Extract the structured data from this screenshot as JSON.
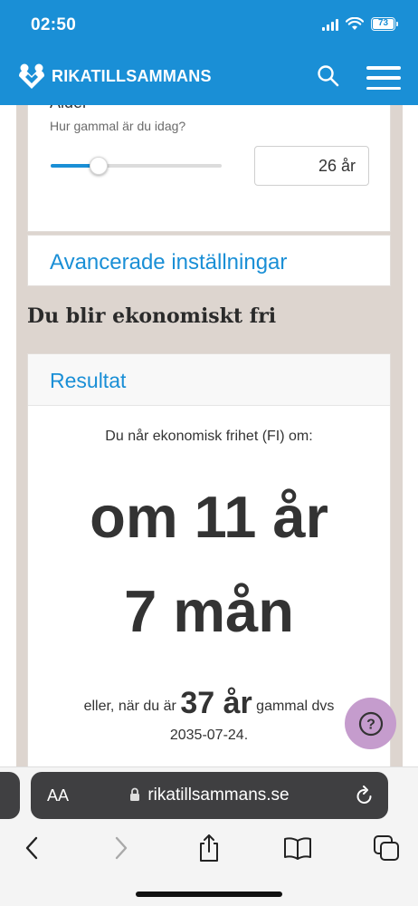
{
  "status_bar": {
    "time": "02:50",
    "battery": "73"
  },
  "header": {
    "logo_text": "RIKATILLSAMMANS"
  },
  "age_card": {
    "label": "Ålder",
    "hint": "Hur gammal är du idag?",
    "slider_fraction": 0.28,
    "value": "26 år"
  },
  "advanced": {
    "label": "Avancerade inställningar"
  },
  "section_title": "Du blir ekonomiskt fri",
  "result": {
    "header": "Resultat",
    "intro": "Du når ekonomisk frihet (FI) om:",
    "years": "om 11 år",
    "months": "7 mån",
    "line_prefix": "eller, när du är",
    "age": "37 år",
    "line_suffix": "gammal dvs",
    "date": "2035-07-24."
  },
  "help": {
    "label": "?"
  },
  "browser": {
    "aa_label": "AA",
    "url": "rikatillsammans.se"
  },
  "colors": {
    "brand_blue": "#1a8fd6",
    "beige": "#ddd5cf",
    "help_bubble": "#c59ccd"
  }
}
